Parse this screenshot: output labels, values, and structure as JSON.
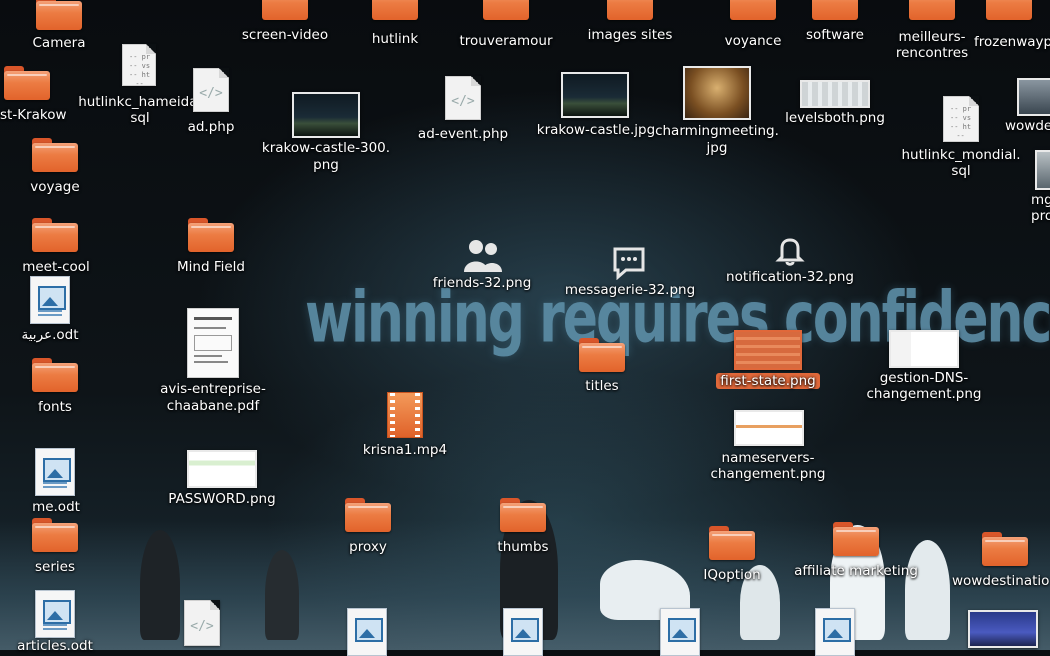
{
  "wallpaper": {
    "slogan": "winning requires confidence"
  },
  "colors": {
    "folder": "#e96f37",
    "selection": "#e0683a",
    "label": "#ffffff"
  },
  "icons": {
    "camera": {
      "label": "Camera",
      "kind": "folder-icon"
    },
    "screen_video": {
      "label": "screen-video",
      "kind": "folder-icon"
    },
    "hutlink": {
      "label": "hutlink",
      "kind": "folder-icon"
    },
    "trouveramour": {
      "label": "trouveramour",
      "kind": "folder-icon"
    },
    "images_sites": {
      "label": "images sites",
      "kind": "folder-icon"
    },
    "voyance": {
      "label": "voyance",
      "kind": "folder-icon"
    },
    "software": {
      "label": "software",
      "kind": "folder-icon"
    },
    "meilleurs_rencontres": {
      "label1": "meilleurs-",
      "label2": "rencontres",
      "kind": "folder-icon"
    },
    "frozenway": {
      "label": "frozenwayp",
      "kind": "folder-icon"
    },
    "krakow": {
      "label": "st-Krakow",
      "kind": "folder-icon"
    },
    "hutlinkc_hameida": {
      "label1": "hutlinkc_hameida.",
      "label2": "sql",
      "kind": "sql-file-icon"
    },
    "ad_php": {
      "label": "ad.php",
      "kind": "code-file-icon"
    },
    "krakow_castle_300": {
      "label1": "krakow-castle-300.",
      "label2": "png",
      "kind": "image-thumbnail"
    },
    "ad_event": {
      "label": "ad-event.php",
      "kind": "code-file-icon"
    },
    "krakow_castle_jpg": {
      "label": "krakow-castle.jpg",
      "kind": "image-thumbnail"
    },
    "charmingmeeting": {
      "label1": "charmingmeeting.",
      "label2": "jpg",
      "kind": "image-thumbnail"
    },
    "levelsboth": {
      "label": "levelsboth.png",
      "kind": "image-thumbnail"
    },
    "wowde": {
      "label": "wowde",
      "kind": "image-thumbnail"
    },
    "hutlinkc_mondial": {
      "label1": "hutlinkc_mondial.",
      "label2": "sql",
      "kind": "sql-file-icon"
    },
    "mg_pro": {
      "label1": "mg",
      "label2": "pro",
      "kind": "image-thumbnail"
    },
    "voyage": {
      "label": "voyage",
      "kind": "folder-icon"
    },
    "meet_cool": {
      "label": "meet-cool",
      "kind": "folder-icon"
    },
    "mind_field": {
      "label": "Mind Field",
      "kind": "folder-icon"
    },
    "friends": {
      "label": "friends-32.png",
      "kind": "friends-icon"
    },
    "messagerie": {
      "label": "messagerie-32.png",
      "kind": "chat-bubble-icon"
    },
    "notification": {
      "label": "notification-32.png",
      "kind": "bell-icon"
    },
    "arabic_odt": {
      "label": "عربية.odt",
      "kind": "odt-file-icon"
    },
    "avis_pdf": {
      "label1": "avis-entreprise-",
      "label2": "chaabane.pdf",
      "kind": "pdf-thumbnail"
    },
    "titles": {
      "label": "titles",
      "kind": "folder-icon"
    },
    "first_state": {
      "label": "first-state.png",
      "kind": "image-thumbnail"
    },
    "gestion_dns": {
      "label1": "gestion-DNS-",
      "label2": "changement.png",
      "kind": "image-thumbnail"
    },
    "fonts": {
      "label": "fonts",
      "kind": "folder-icon"
    },
    "krisna": {
      "label": "krisna1.mp4",
      "kind": "video-file-icon"
    },
    "nameservers": {
      "label1": "nameservers-",
      "label2": "changement.png",
      "kind": "image-thumbnail"
    },
    "me_odt": {
      "label": "me.odt",
      "kind": "odt-file-icon"
    },
    "password": {
      "label": "PASSWORD.png",
      "kind": "image-thumbnail"
    },
    "proxy": {
      "label": "proxy",
      "kind": "folder-icon"
    },
    "thumbs": {
      "label": "thumbs",
      "kind": "folder-icon"
    },
    "iqoption": {
      "label": "IQoption",
      "kind": "folder-icon"
    },
    "affiliate": {
      "label": "affiliate marketing",
      "kind": "folder-icon"
    },
    "wowdestination": {
      "label": "wowdestinatio",
      "kind": "folder-icon"
    },
    "series": {
      "label": "series",
      "kind": "folder-icon"
    },
    "articles_odt": {
      "label": "articles.odt",
      "kind": "odt-file-icon"
    }
  }
}
